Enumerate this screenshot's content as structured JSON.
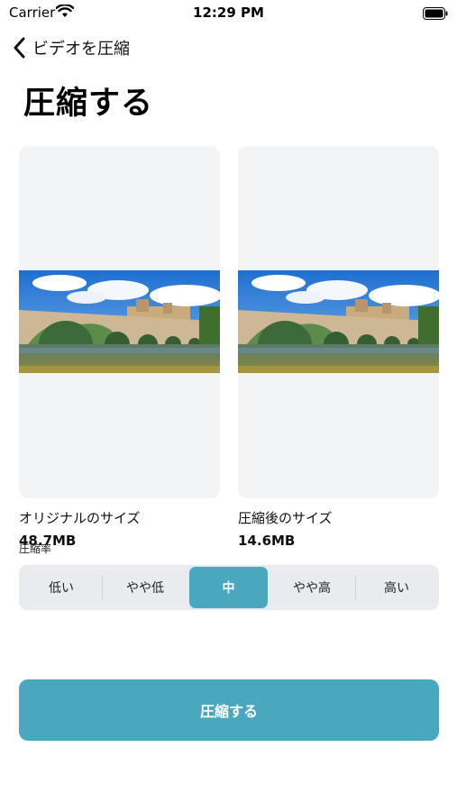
{
  "status_bar": {
    "carrier": "Carrier",
    "time": "12:29 PM"
  },
  "nav": {
    "back_label": "ビデオを圧縮"
  },
  "page": {
    "title": "圧縮する"
  },
  "previews": {
    "original": {
      "label": "オリジナルのサイズ",
      "size": "48.7MB"
    },
    "compressed": {
      "label": "圧縮後のサイズ",
      "size": "14.6MB"
    }
  },
  "compression": {
    "label": "圧縮率",
    "options": [
      "低い",
      "やや低",
      "中",
      "やや高",
      "高い"
    ],
    "selected": "中"
  },
  "action": {
    "compress_label": "圧縮する"
  },
  "colors": {
    "accent": "#4aa8be",
    "card_bg": "#f3f4f6",
    "segment_bg": "#e9ebee"
  }
}
